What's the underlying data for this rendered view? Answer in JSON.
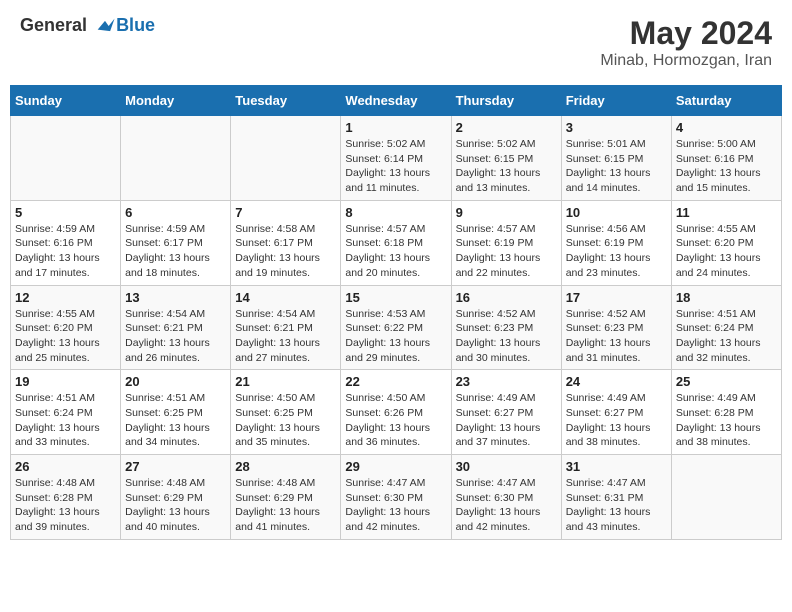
{
  "header": {
    "logo_line1": "General",
    "logo_line2": "Blue",
    "title": "May 2024",
    "subtitle": "Minab, Hormozgan, Iran"
  },
  "columns": [
    "Sunday",
    "Monday",
    "Tuesday",
    "Wednesday",
    "Thursday",
    "Friday",
    "Saturday"
  ],
  "weeks": [
    [
      {
        "day": "",
        "sunrise": "",
        "sunset": "",
        "daylight": ""
      },
      {
        "day": "",
        "sunrise": "",
        "sunset": "",
        "daylight": ""
      },
      {
        "day": "",
        "sunrise": "",
        "sunset": "",
        "daylight": ""
      },
      {
        "day": "1",
        "sunrise": "Sunrise: 5:02 AM",
        "sunset": "Sunset: 6:14 PM",
        "daylight": "Daylight: 13 hours and 11 minutes."
      },
      {
        "day": "2",
        "sunrise": "Sunrise: 5:02 AM",
        "sunset": "Sunset: 6:15 PM",
        "daylight": "Daylight: 13 hours and 13 minutes."
      },
      {
        "day": "3",
        "sunrise": "Sunrise: 5:01 AM",
        "sunset": "Sunset: 6:15 PM",
        "daylight": "Daylight: 13 hours and 14 minutes."
      },
      {
        "day": "4",
        "sunrise": "Sunrise: 5:00 AM",
        "sunset": "Sunset: 6:16 PM",
        "daylight": "Daylight: 13 hours and 15 minutes."
      }
    ],
    [
      {
        "day": "5",
        "sunrise": "Sunrise: 4:59 AM",
        "sunset": "Sunset: 6:16 PM",
        "daylight": "Daylight: 13 hours and 17 minutes."
      },
      {
        "day": "6",
        "sunrise": "Sunrise: 4:59 AM",
        "sunset": "Sunset: 6:17 PM",
        "daylight": "Daylight: 13 hours and 18 minutes."
      },
      {
        "day": "7",
        "sunrise": "Sunrise: 4:58 AM",
        "sunset": "Sunset: 6:17 PM",
        "daylight": "Daylight: 13 hours and 19 minutes."
      },
      {
        "day": "8",
        "sunrise": "Sunrise: 4:57 AM",
        "sunset": "Sunset: 6:18 PM",
        "daylight": "Daylight: 13 hours and 20 minutes."
      },
      {
        "day": "9",
        "sunrise": "Sunrise: 4:57 AM",
        "sunset": "Sunset: 6:19 PM",
        "daylight": "Daylight: 13 hours and 22 minutes."
      },
      {
        "day": "10",
        "sunrise": "Sunrise: 4:56 AM",
        "sunset": "Sunset: 6:19 PM",
        "daylight": "Daylight: 13 hours and 23 minutes."
      },
      {
        "day": "11",
        "sunrise": "Sunrise: 4:55 AM",
        "sunset": "Sunset: 6:20 PM",
        "daylight": "Daylight: 13 hours and 24 minutes."
      }
    ],
    [
      {
        "day": "12",
        "sunrise": "Sunrise: 4:55 AM",
        "sunset": "Sunset: 6:20 PM",
        "daylight": "Daylight: 13 hours and 25 minutes."
      },
      {
        "day": "13",
        "sunrise": "Sunrise: 4:54 AM",
        "sunset": "Sunset: 6:21 PM",
        "daylight": "Daylight: 13 hours and 26 minutes."
      },
      {
        "day": "14",
        "sunrise": "Sunrise: 4:54 AM",
        "sunset": "Sunset: 6:21 PM",
        "daylight": "Daylight: 13 hours and 27 minutes."
      },
      {
        "day": "15",
        "sunrise": "Sunrise: 4:53 AM",
        "sunset": "Sunset: 6:22 PM",
        "daylight": "Daylight: 13 hours and 29 minutes."
      },
      {
        "day": "16",
        "sunrise": "Sunrise: 4:52 AM",
        "sunset": "Sunset: 6:23 PM",
        "daylight": "Daylight: 13 hours and 30 minutes."
      },
      {
        "day": "17",
        "sunrise": "Sunrise: 4:52 AM",
        "sunset": "Sunset: 6:23 PM",
        "daylight": "Daylight: 13 hours and 31 minutes."
      },
      {
        "day": "18",
        "sunrise": "Sunrise: 4:51 AM",
        "sunset": "Sunset: 6:24 PM",
        "daylight": "Daylight: 13 hours and 32 minutes."
      }
    ],
    [
      {
        "day": "19",
        "sunrise": "Sunrise: 4:51 AM",
        "sunset": "Sunset: 6:24 PM",
        "daylight": "Daylight: 13 hours and 33 minutes."
      },
      {
        "day": "20",
        "sunrise": "Sunrise: 4:51 AM",
        "sunset": "Sunset: 6:25 PM",
        "daylight": "Daylight: 13 hours and 34 minutes."
      },
      {
        "day": "21",
        "sunrise": "Sunrise: 4:50 AM",
        "sunset": "Sunset: 6:25 PM",
        "daylight": "Daylight: 13 hours and 35 minutes."
      },
      {
        "day": "22",
        "sunrise": "Sunrise: 4:50 AM",
        "sunset": "Sunset: 6:26 PM",
        "daylight": "Daylight: 13 hours and 36 minutes."
      },
      {
        "day": "23",
        "sunrise": "Sunrise: 4:49 AM",
        "sunset": "Sunset: 6:27 PM",
        "daylight": "Daylight: 13 hours and 37 minutes."
      },
      {
        "day": "24",
        "sunrise": "Sunrise: 4:49 AM",
        "sunset": "Sunset: 6:27 PM",
        "daylight": "Daylight: 13 hours and 38 minutes."
      },
      {
        "day": "25",
        "sunrise": "Sunrise: 4:49 AM",
        "sunset": "Sunset: 6:28 PM",
        "daylight": "Daylight: 13 hours and 38 minutes."
      }
    ],
    [
      {
        "day": "26",
        "sunrise": "Sunrise: 4:48 AM",
        "sunset": "Sunset: 6:28 PM",
        "daylight": "Daylight: 13 hours and 39 minutes."
      },
      {
        "day": "27",
        "sunrise": "Sunrise: 4:48 AM",
        "sunset": "Sunset: 6:29 PM",
        "daylight": "Daylight: 13 hours and 40 minutes."
      },
      {
        "day": "28",
        "sunrise": "Sunrise: 4:48 AM",
        "sunset": "Sunset: 6:29 PM",
        "daylight": "Daylight: 13 hours and 41 minutes."
      },
      {
        "day": "29",
        "sunrise": "Sunrise: 4:47 AM",
        "sunset": "Sunset: 6:30 PM",
        "daylight": "Daylight: 13 hours and 42 minutes."
      },
      {
        "day": "30",
        "sunrise": "Sunrise: 4:47 AM",
        "sunset": "Sunset: 6:30 PM",
        "daylight": "Daylight: 13 hours and 42 minutes."
      },
      {
        "day": "31",
        "sunrise": "Sunrise: 4:47 AM",
        "sunset": "Sunset: 6:31 PM",
        "daylight": "Daylight: 13 hours and 43 minutes."
      },
      {
        "day": "",
        "sunrise": "",
        "sunset": "",
        "daylight": ""
      }
    ]
  ]
}
